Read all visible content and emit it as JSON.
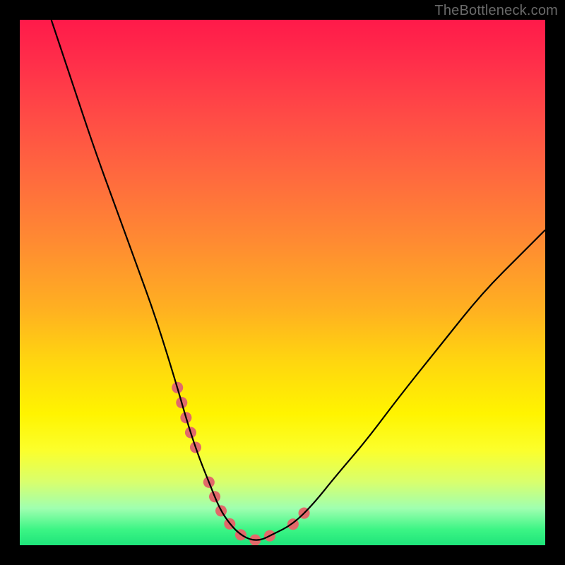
{
  "watermark": "TheBottleneck.com",
  "chart_data": {
    "type": "line",
    "title": "",
    "xlabel": "",
    "ylabel": "",
    "xlim": [
      0,
      100
    ],
    "ylim": [
      0,
      100
    ],
    "series": [
      {
        "name": "bottleneck-curve",
        "x": [
          6,
          10,
          14,
          18,
          22,
          26,
          30,
          32,
          34,
          36,
          38,
          40,
          42,
          44,
          46,
          48,
          52,
          56,
          60,
          66,
          72,
          80,
          88,
          96,
          100
        ],
        "y": [
          100,
          88,
          76,
          65,
          54,
          43,
          30,
          23,
          17,
          12,
          7,
          4,
          2,
          1,
          1,
          2,
          4,
          8,
          13,
          20,
          28,
          38,
          48,
          56,
          60
        ]
      }
    ],
    "highlight_segments": [
      {
        "x": [
          30,
          32,
          34
        ],
        "y": [
          30,
          23,
          17
        ]
      },
      {
        "x": [
          36,
          38,
          40,
          42,
          44,
          46,
          48
        ],
        "y": [
          12,
          7,
          4,
          2,
          1,
          1,
          2
        ]
      },
      {
        "x": [
          52,
          56
        ],
        "y": [
          4,
          8
        ]
      }
    ],
    "colors": {
      "curve": "#000000",
      "highlight": "#e16a6a",
      "gradient_top": "#ff1a4a",
      "gradient_mid": "#fff400",
      "gradient_bottom": "#1ee47a",
      "frame": "#000000"
    }
  }
}
